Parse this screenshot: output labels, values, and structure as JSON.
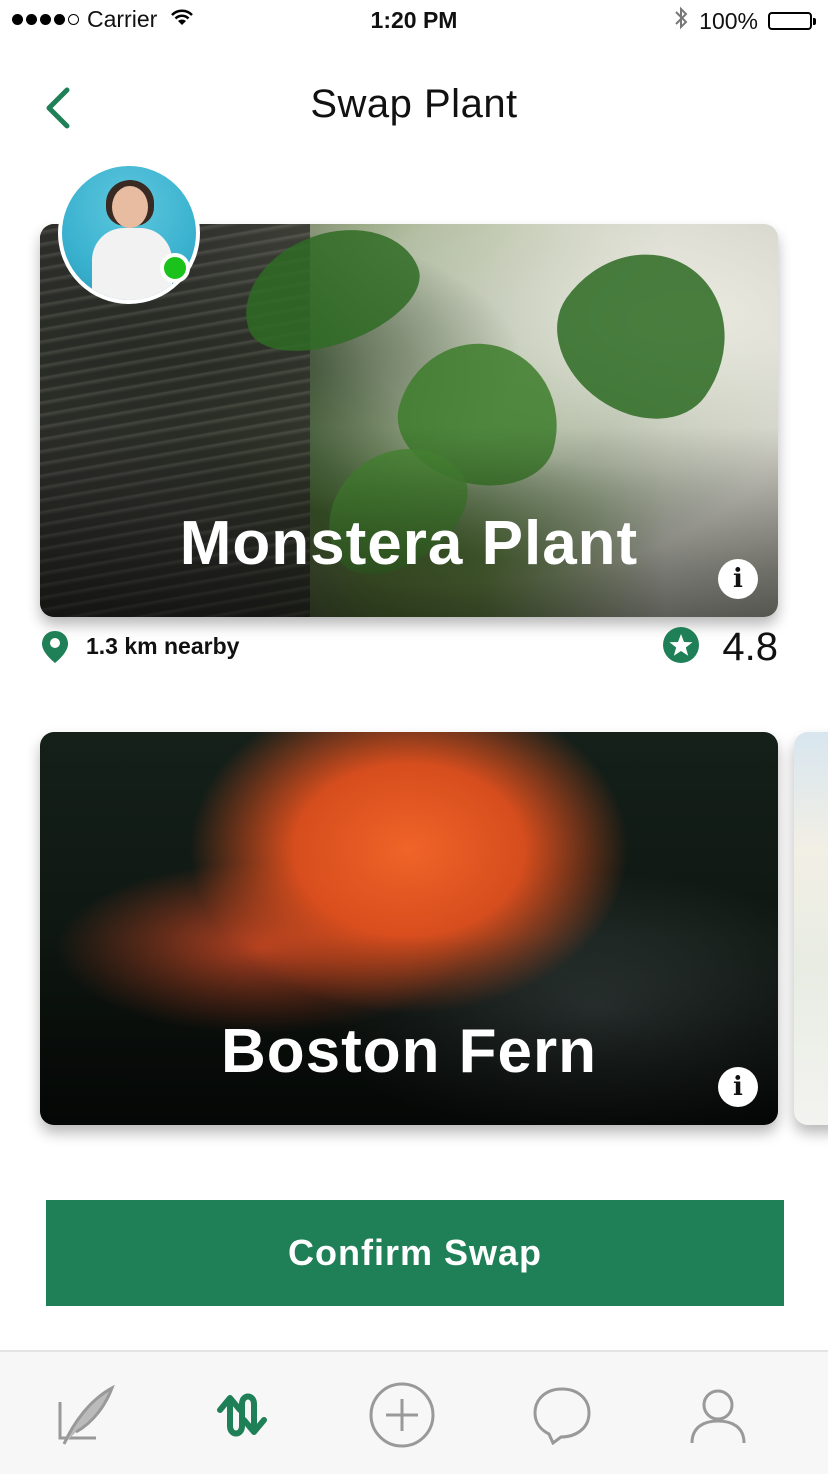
{
  "status_bar": {
    "carrier": "Carrier",
    "time": "1:20 PM",
    "battery": "100%"
  },
  "header": {
    "title": "Swap Plant",
    "back_icon": "chevron-left-icon"
  },
  "colors": {
    "accent": "#1f7f57",
    "online": "#1bc21b"
  },
  "owner": {
    "avatar": "user-avatar",
    "online": true
  },
  "cards": [
    {
      "title": "Monstera Plant",
      "info_icon": "info-icon"
    },
    {
      "title": "Boston Fern",
      "info_icon": "info-icon"
    }
  ],
  "meta": {
    "distance": "1.3 km nearby",
    "rating": "4.8"
  },
  "confirm_label": "Confirm Swap",
  "tabs": [
    {
      "icon": "feather-icon",
      "active": false
    },
    {
      "icon": "swap-icon",
      "active": true
    },
    {
      "icon": "add-icon",
      "active": false
    },
    {
      "icon": "chat-icon",
      "active": false
    },
    {
      "icon": "profile-icon",
      "active": false
    }
  ]
}
